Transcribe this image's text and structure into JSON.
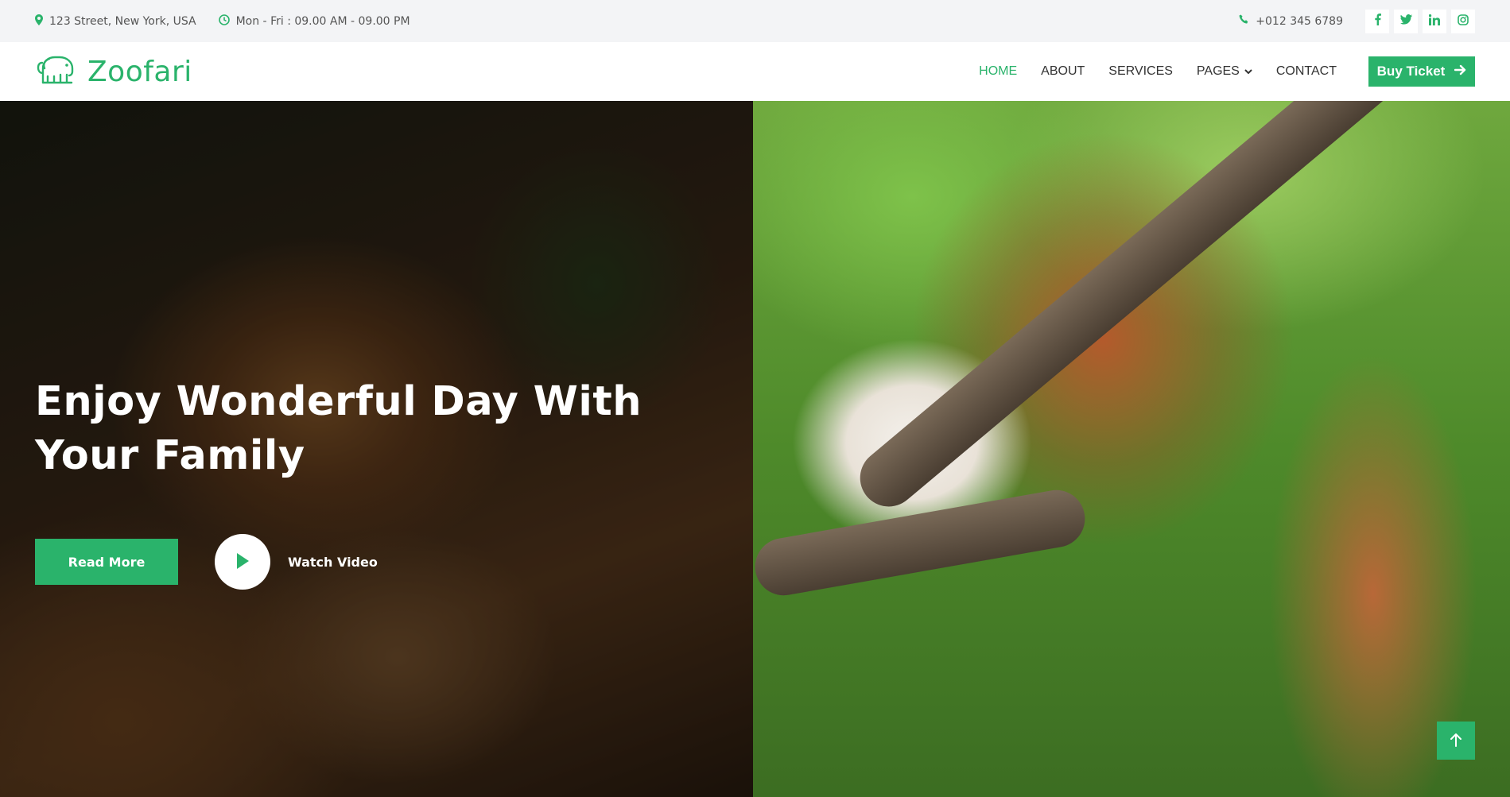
{
  "topbar": {
    "address": "123 Street, New York, USA",
    "hours": "Mon - Fri : 09.00 AM - 09.00 PM",
    "phone": "+012 345 6789",
    "social": [
      "facebook-icon",
      "twitter-icon",
      "linkedin-icon",
      "instagram-icon"
    ]
  },
  "navbar": {
    "brand": "Zoofari",
    "items": [
      {
        "label": "HOME",
        "active": true
      },
      {
        "label": "ABOUT"
      },
      {
        "label": "SERVICES"
      },
      {
        "label": "PAGES",
        "dropdown": true
      },
      {
        "label": "CONTACT"
      }
    ],
    "cta": "Buy Ticket"
  },
  "hero": {
    "title": "Enjoy Wonderful Day With Your Family",
    "read_more": "Read More",
    "watch_video": "Watch Video"
  },
  "colors": {
    "accent": "#2ab36b",
    "topbar_bg": "#f3f4f6"
  }
}
